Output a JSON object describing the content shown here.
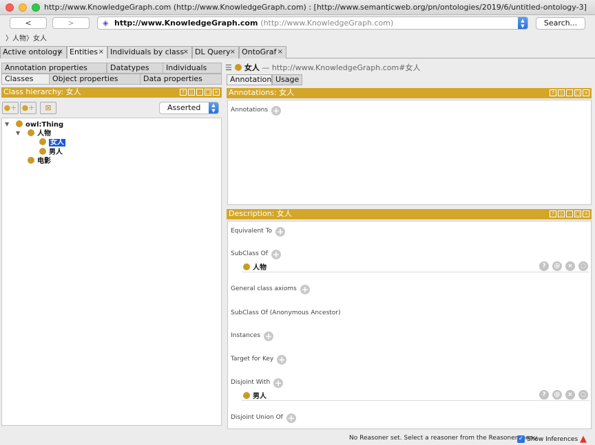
{
  "window": {
    "title": "http://www.KnowledgeGraph.com (http://www.KnowledgeGraph.com)  : [http://www.semanticweb.org/pn/ontologies/2019/6/untitled-ontology-3]"
  },
  "toolbar": {
    "back_label": "<",
    "forward_label": ">",
    "address_url": "http://www.KnowledgeGraph.com",
    "address_hint": "(http://www.KnowledgeGraph.com)",
    "search_label": "Search..."
  },
  "breadcrumb": "〉人物〉女人",
  "tabs": [
    {
      "label": "Active ontology",
      "active": false
    },
    {
      "label": "Entities",
      "active": true
    },
    {
      "label": "Individuals by class",
      "active": false
    },
    {
      "label": "DL Query",
      "active": false
    },
    {
      "label": "OntoGraf",
      "active": false
    }
  ],
  "left": {
    "subtabs_row1": [
      "Annotation properties",
      "Datatypes",
      "Individuals"
    ],
    "subtabs_row2": [
      "Classes",
      "Object properties",
      "Data properties"
    ],
    "hierarchy_title": "Class hierarchy: 女人",
    "asserted_label": "Asserted",
    "tree": {
      "root": "owl:Thing",
      "n1": "人物",
      "n1a": "女人",
      "n1b": "男人",
      "n2": "电影"
    }
  },
  "right": {
    "entity_name": "女人",
    "entity_iri": "— http://www.KnowledgeGraph.com#女人",
    "tabs": [
      "Annotations",
      "Usage"
    ],
    "annotations_title": "Annotations: 女人",
    "annotations_label": "Annotations",
    "description_title": "Description: 女人",
    "frames": {
      "equivalent": "Equivalent To",
      "subclass": "SubClass Of",
      "subclass_item": "人物",
      "general": "General class axioms",
      "anon": "SubClass Of (Anonymous Ancestor)",
      "instances": "Instances",
      "target": "Target for Key",
      "disjoint": "Disjoint With",
      "disjoint_item": "男人",
      "union": "Disjoint Union Of"
    }
  },
  "status": {
    "reasoner_text": "No Reasoner set. Select a reasoner from the Reasoner menu",
    "show_inferences": "Show Inferences"
  },
  "colors": {
    "accent_gold": "#d4a628",
    "class_dot": "#c99a26",
    "selection": "#1a5ad6"
  }
}
